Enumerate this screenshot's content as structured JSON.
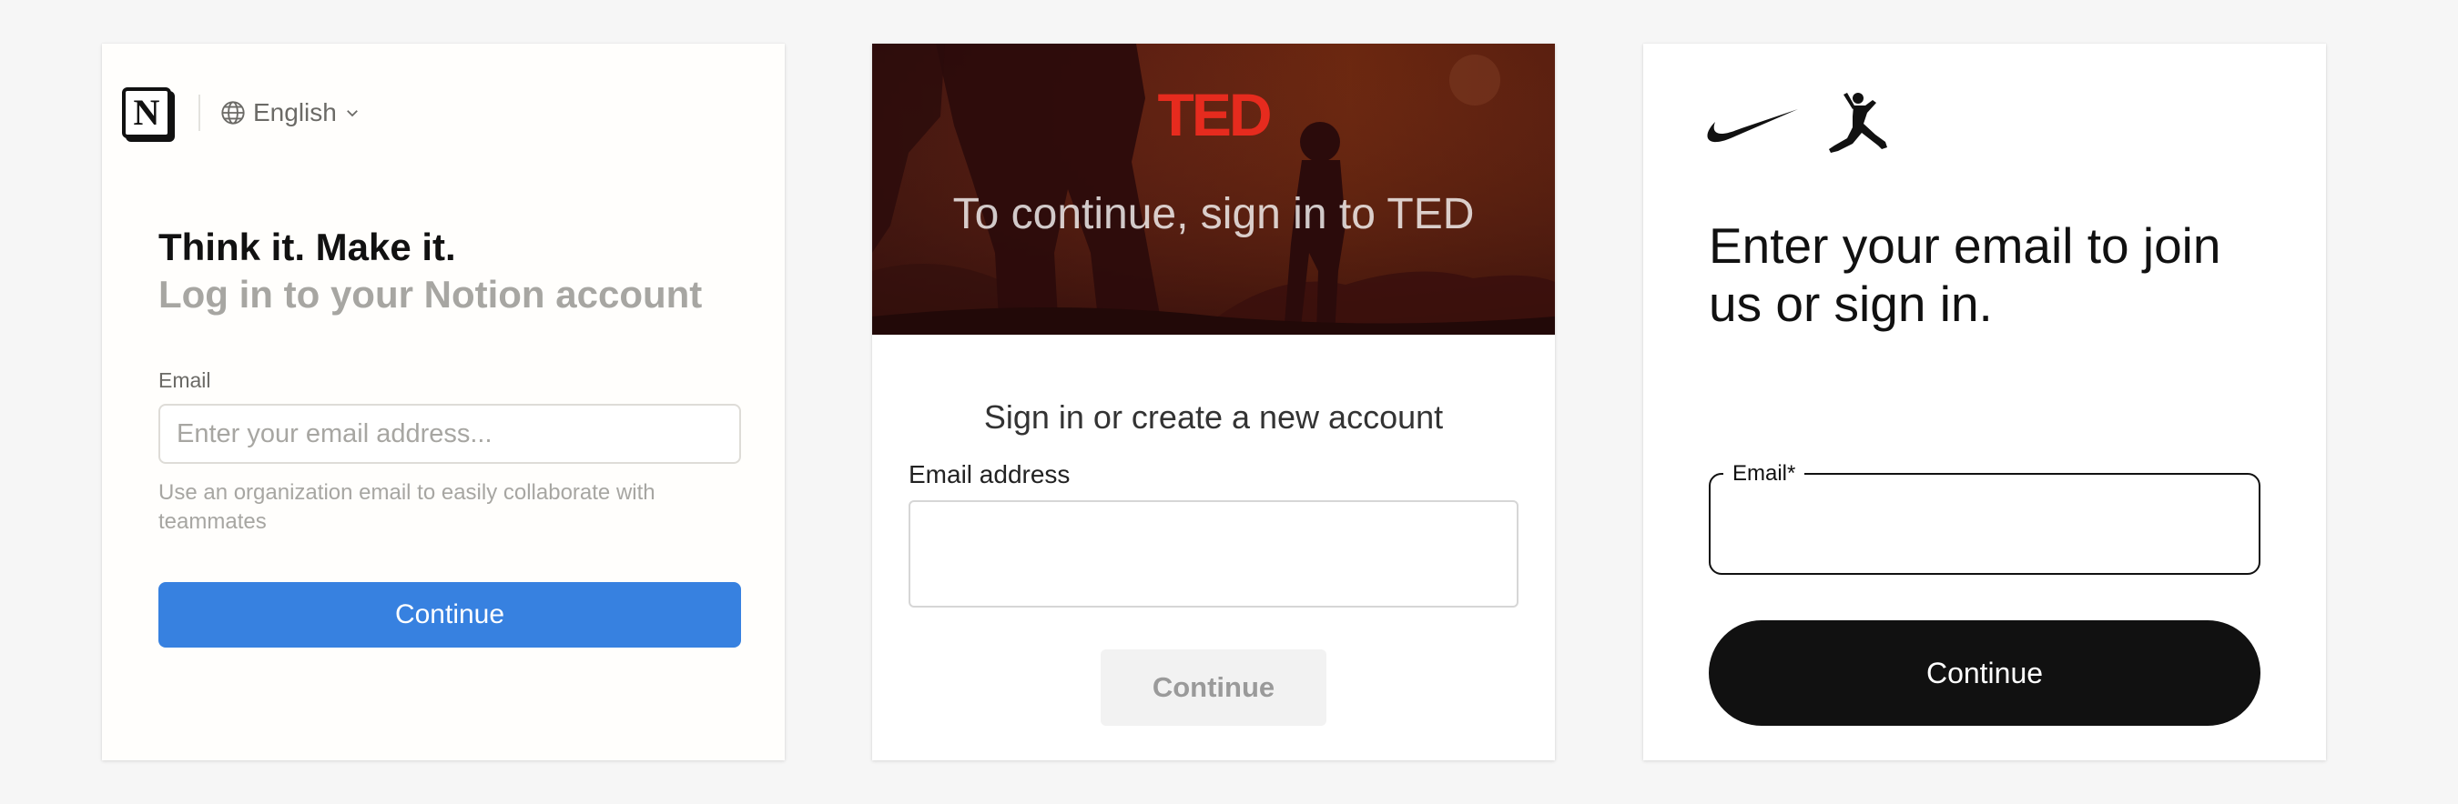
{
  "notion": {
    "logo_letter": "N",
    "language": "English",
    "headline": "Think it. Make it.",
    "subheadline": "Log in to your Notion account",
    "email_label": "Email",
    "email_placeholder": "Enter your email address...",
    "hint": "Use an organization email to easily collaborate with teammates",
    "continue_label": "Continue",
    "accent_color": "#3781e0"
  },
  "ted": {
    "logo": "TED",
    "hero_text": "To continue, sign in to TED",
    "title": "Sign in or create a new account",
    "email_label": "Email address",
    "continue_label": "Continue",
    "brand_color": "#e62b1e"
  },
  "nike": {
    "headline": "Enter your email to join us or sign in.",
    "email_label": "Email*",
    "continue_label": "Continue",
    "icons": [
      "nike-swoosh-icon",
      "jordan-jumpman-icon"
    ]
  }
}
